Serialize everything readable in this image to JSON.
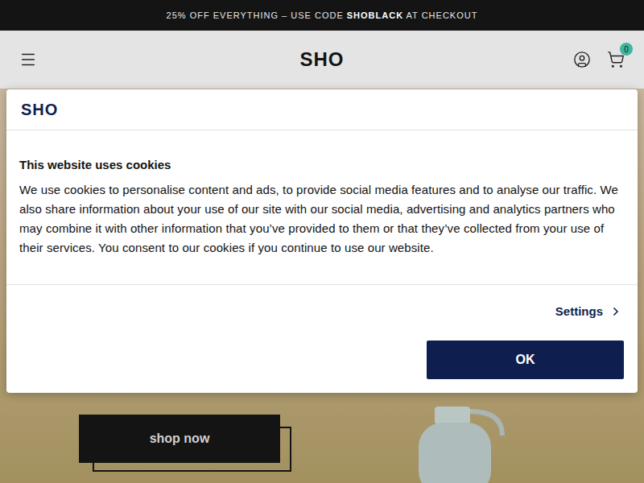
{
  "announcement": {
    "parts": [
      {
        "text": "25% OFF EVERYTHING – USE CODE ",
        "bold": false
      },
      {
        "text": "SHOBLACK",
        "bold": true
      },
      {
        "text": " AT CHECKOUT",
        "bold": false
      }
    ]
  },
  "header": {
    "logo": "SHO",
    "cart_count": "0"
  },
  "hero": {
    "button": "shop now"
  },
  "cookie_dialog": {
    "logo": "SHO",
    "title": "This website uses cookies",
    "body": "We use cookies to personalise content and ads, to provide social media features and to analyse our traffic. We also share information about your use of our site with our social media, advertising and analytics partners who may combine it with other information that you’ve provided to them or that they’ve collected from your use of their services. You consent to our cookies if you continue to use our website.",
    "settings": "Settings",
    "ok": "OK"
  }
}
